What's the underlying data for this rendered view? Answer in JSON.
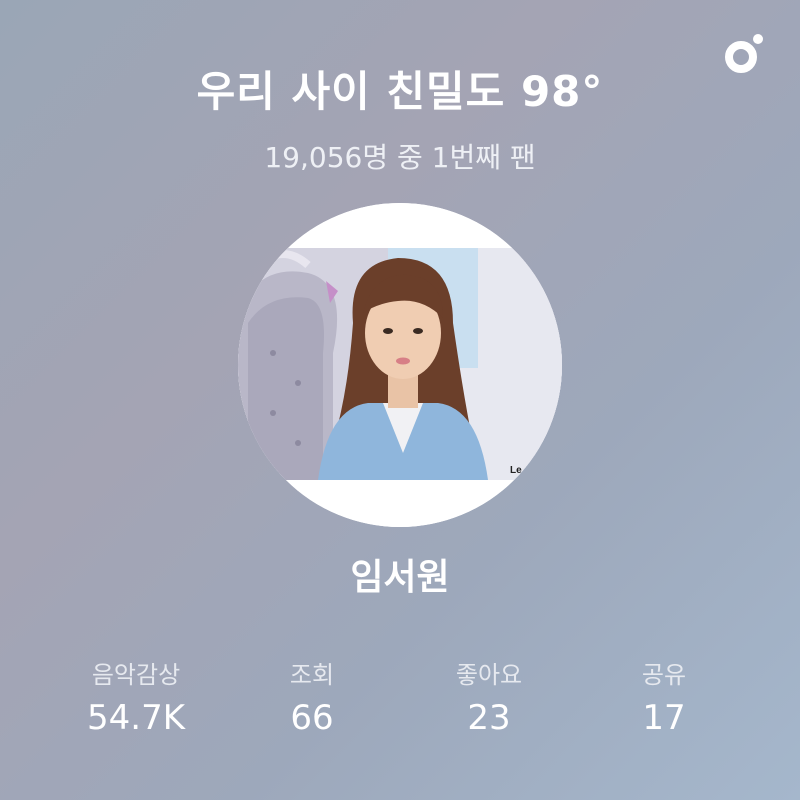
{
  "header": {
    "title": "우리 사이 친밀도 98°",
    "subtitle": "19,056명 중 1번째 팬"
  },
  "logo": {
    "icon": "brand-ring-logo-icon"
  },
  "profile": {
    "avatar_icon": "artist-photo",
    "photo_watermark": "Le",
    "name": "임서원"
  },
  "stats": [
    {
      "label": "음악감상",
      "value": "54.7K"
    },
    {
      "label": "조회",
      "value": "66"
    },
    {
      "label": "좋아요",
      "value": "23"
    },
    {
      "label": "공유",
      "value": "17"
    }
  ],
  "colors": {
    "background_start": "#9aa6b6",
    "background_end": "#a5b7cc",
    "text": "#ffffff"
  }
}
